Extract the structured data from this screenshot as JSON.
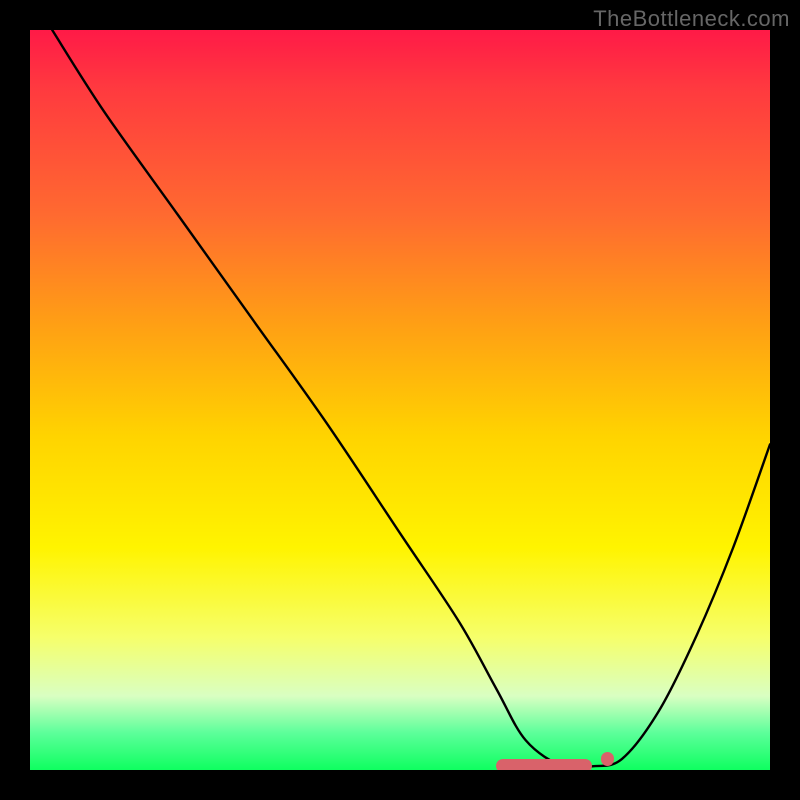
{
  "watermark": "TheBottleneck.com",
  "chart_data": {
    "type": "line",
    "title": "",
    "xlabel": "",
    "ylabel": "",
    "xlim": [
      0,
      100
    ],
    "ylim": [
      0,
      100
    ],
    "series": [
      {
        "name": "bottleneck-curve",
        "x": [
          3,
          10,
          20,
          30,
          40,
          50,
          58,
          63,
          67,
          72,
          76,
          80,
          85,
          90,
          95,
          100
        ],
        "y": [
          100,
          89,
          75,
          61,
          47,
          32,
          20,
          11,
          4,
          0.5,
          0.5,
          1.5,
          8,
          18,
          30,
          44
        ]
      }
    ],
    "markers": {
      "name": "optimal-band",
      "color": "#d9626a",
      "shape": "pill",
      "x_range": [
        63,
        76
      ],
      "y": 0.5,
      "dot": {
        "x": 78,
        "y": 1.5,
        "r": 0.9
      }
    },
    "background_gradient": [
      "#ff1a47",
      "#ff3a3f",
      "#ff6a30",
      "#ffa014",
      "#ffd400",
      "#fff400",
      "#f6ff6a",
      "#d9ffc2",
      "#5cff9a",
      "#0fff60"
    ]
  }
}
